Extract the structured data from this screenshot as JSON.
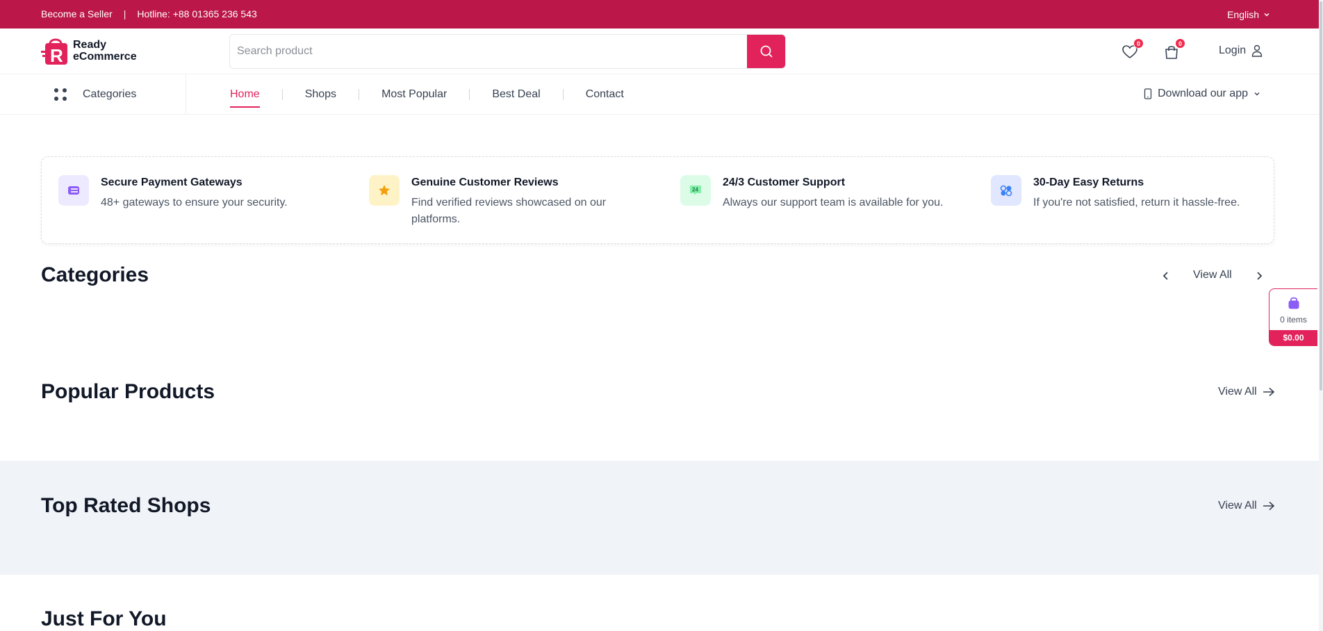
{
  "topbar": {
    "become_seller": "Become a Seller",
    "separator": "|",
    "hotline": "Hotline: +88 01365 236 543",
    "language": "English"
  },
  "header": {
    "logo_line1": "Ready",
    "logo_line2": "eCommerce",
    "search_placeholder": "Search product",
    "wishlist_count": "0",
    "cart_count": "0",
    "login_label": "Login"
  },
  "nav": {
    "categories_label": "Categories",
    "items": [
      {
        "label": "Home",
        "active": true
      },
      {
        "label": "Shops"
      },
      {
        "label": "Most Popular"
      },
      {
        "label": "Best Deal"
      },
      {
        "label": "Contact"
      }
    ],
    "download_label": "Download our app"
  },
  "features": [
    {
      "title": "Secure Payment Gateways",
      "desc": "48+ gateways to ensure your security.",
      "icon": "payment-card-icon",
      "bg": "#ede9fe"
    },
    {
      "title": "Genuine Customer Reviews",
      "desc": "Find verified reviews showcased on our platforms.",
      "icon": "star-icon",
      "bg": "#fef3c7"
    },
    {
      "title": "24/3 Customer Support",
      "desc": "Always our support team is available for you.",
      "icon": "support-24-icon",
      "icon_text": "24",
      "bg": "#dcfce7"
    },
    {
      "title": "30-Day Easy Returns",
      "desc": "If you're not satisfied, return it hassle-free.",
      "icon": "returns-icon",
      "bg": "#e0e7ff"
    }
  ],
  "sections": {
    "categories_title": "Categories",
    "categories_view_all": "View All",
    "popular_title": "Popular Products",
    "popular_view_all": "View All",
    "shops_title": "Top Rated Shops",
    "shops_view_all": "View All",
    "jfy_title": "Just For You"
  },
  "float_cart": {
    "count_label": "0 items",
    "total": "$0.00"
  },
  "colors": {
    "brand": "#bb1748",
    "accent": "#e1225b"
  }
}
